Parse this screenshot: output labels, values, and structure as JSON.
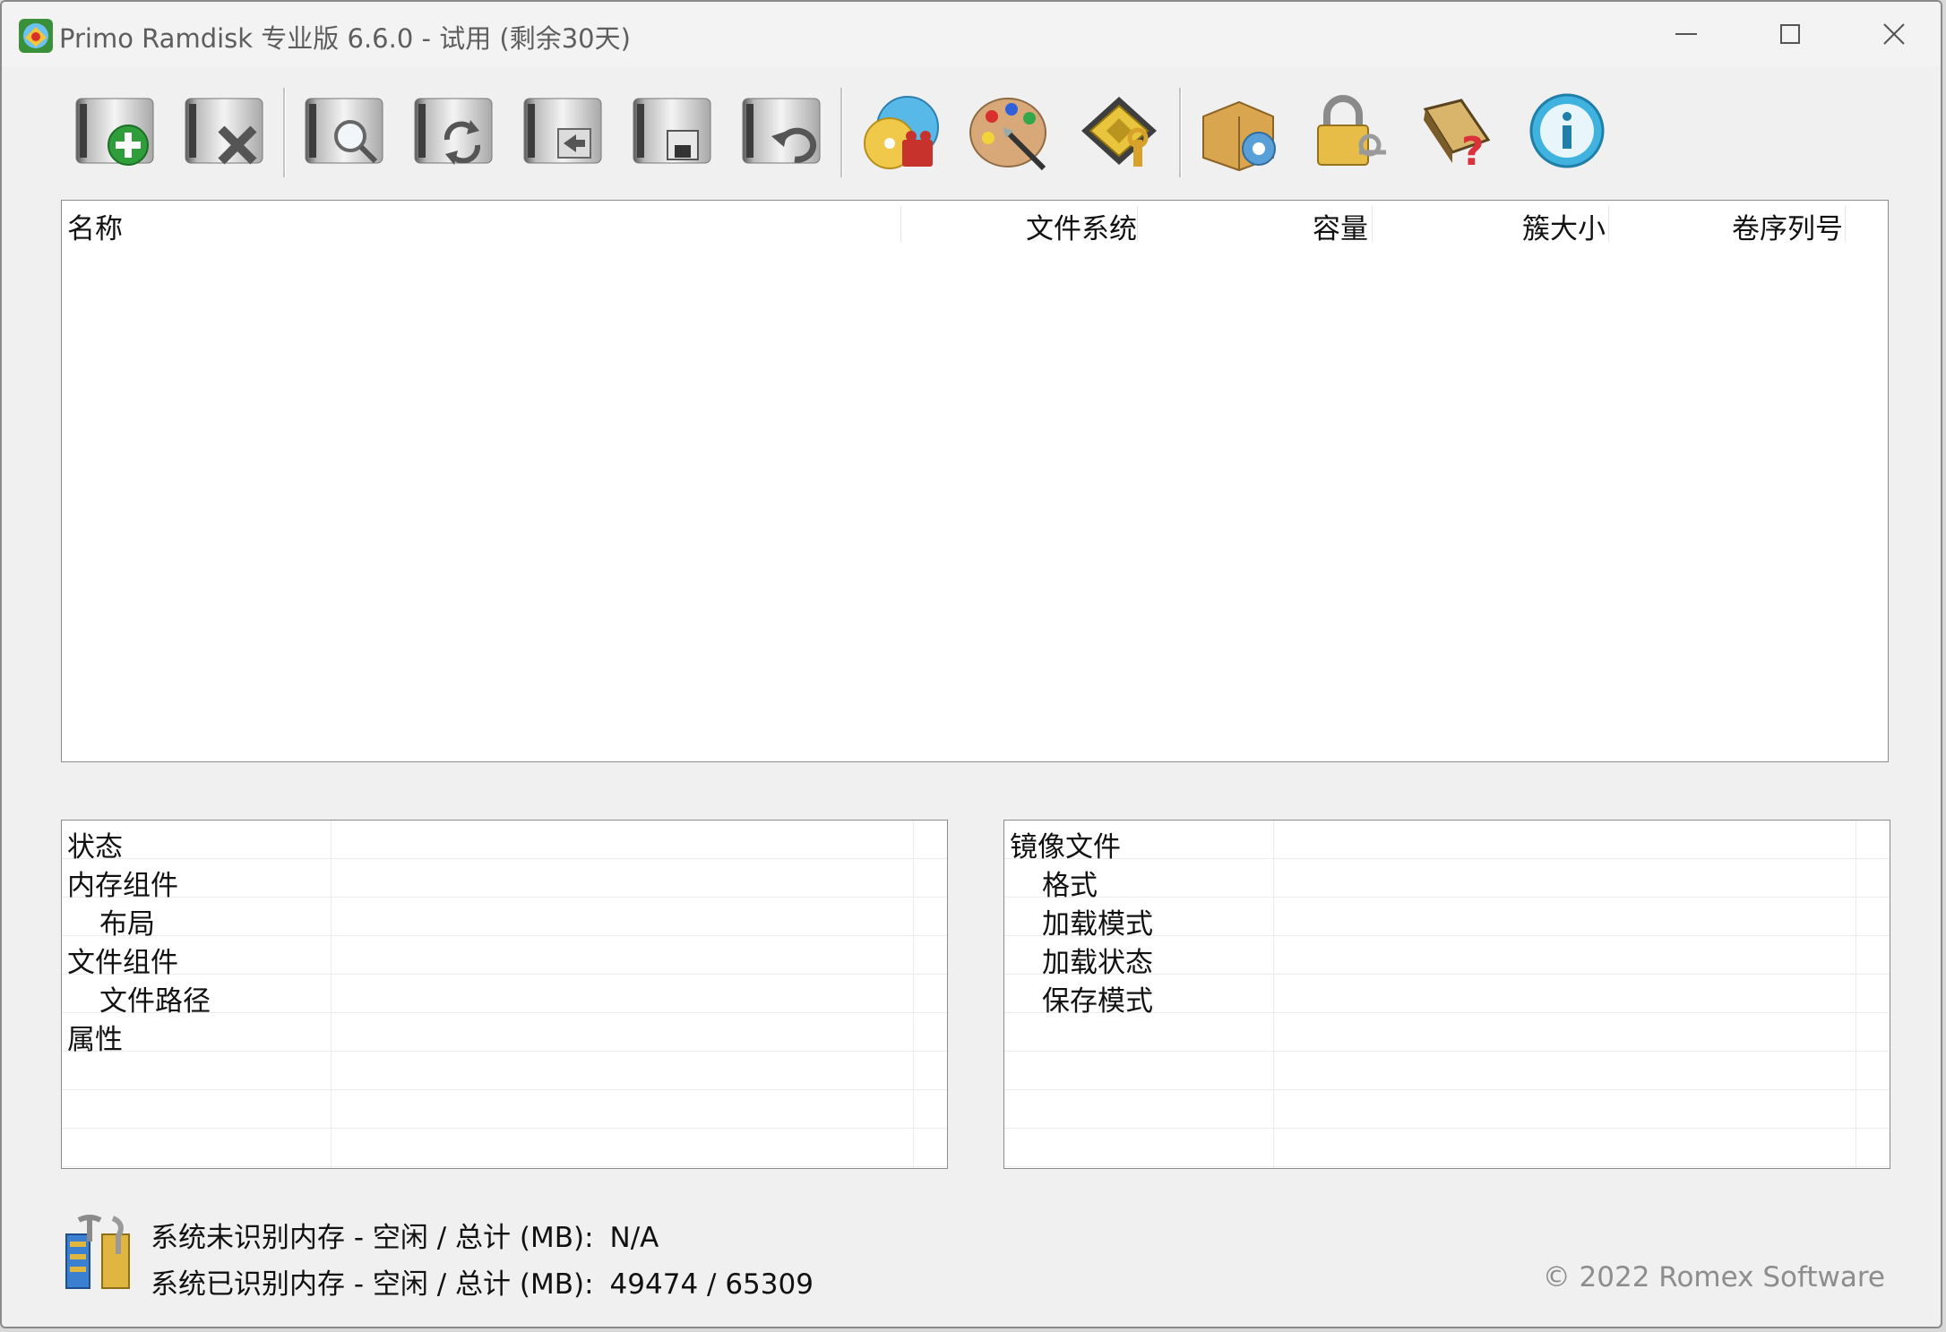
{
  "window": {
    "title": "Primo Ramdisk 专业版 6.6.0 - 试用 (剩余30天)"
  },
  "toolbar": {
    "buttons": [
      {
        "name": "new-disk",
        "icon": "disk-add-icon"
      },
      {
        "name": "delete-disk",
        "icon": "disk-delete-icon"
      },
      {
        "name": "view-disk",
        "icon": "disk-search-icon"
      },
      {
        "name": "refresh-disk",
        "icon": "disk-refresh-icon"
      },
      {
        "name": "import-disk",
        "icon": "disk-import-icon"
      },
      {
        "name": "save-disk",
        "icon": "disk-save-icon"
      },
      {
        "name": "restore-disk",
        "icon": "disk-restore-icon"
      },
      {
        "name": "media",
        "icon": "media-cd-icon"
      },
      {
        "name": "customize",
        "icon": "palette-icon"
      },
      {
        "name": "memory-config",
        "icon": "cpu-chip-icon"
      },
      {
        "name": "options",
        "icon": "box-gear-icon"
      },
      {
        "name": "license",
        "icon": "lock-key-icon"
      },
      {
        "name": "help",
        "icon": "book-help-icon"
      },
      {
        "name": "about",
        "icon": "info-icon"
      }
    ]
  },
  "disk_list": {
    "columns": [
      "名称",
      "文件系统",
      "容量",
      "簇大小",
      "卷序列号"
    ],
    "rows": []
  },
  "status_grid": {
    "rows": [
      {
        "label": "状态",
        "indent": false
      },
      {
        "label": "内存组件",
        "indent": false
      },
      {
        "label": "布局",
        "indent": true
      },
      {
        "label": "文件组件",
        "indent": false
      },
      {
        "label": "文件路径",
        "indent": true
      },
      {
        "label": "属性",
        "indent": false
      }
    ]
  },
  "image_grid": {
    "rows": [
      {
        "label": "镜像文件",
        "indent": false
      },
      {
        "label": "格式",
        "indent": true
      },
      {
        "label": "加载模式",
        "indent": true
      },
      {
        "label": "加载状态",
        "indent": true
      },
      {
        "label": "保存模式",
        "indent": true
      }
    ]
  },
  "footer": {
    "unrecognized_label": "系统未识别内存 - 空闲 / 总计 (MB):",
    "unrecognized_value": "N/A",
    "recognized_label": "系统已识别内存 - 空闲 / 总计 (MB):",
    "recognized_value": "49474 / 65309",
    "copyright": "© 2022 Romex Software"
  },
  "colors": {
    "window_bg": "#f0f0f0",
    "panel_bg": "#ffffff",
    "border": "#8c8c8c",
    "copyright_text": "#8d8d8d"
  }
}
